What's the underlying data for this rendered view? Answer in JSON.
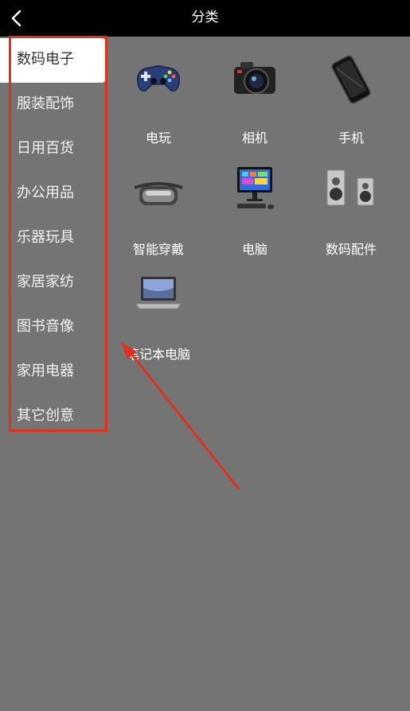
{
  "header": {
    "title": "分类"
  },
  "sidebar": {
    "items": [
      {
        "label": "数码电子",
        "active": true
      },
      {
        "label": "服装配饰"
      },
      {
        "label": "日用百货"
      },
      {
        "label": "办公用品"
      },
      {
        "label": "乐器玩具"
      },
      {
        "label": "家居家纺"
      },
      {
        "label": "图书音像"
      },
      {
        "label": "家用电器"
      },
      {
        "label": "其它创意"
      }
    ]
  },
  "products": [
    {
      "label": "电玩",
      "icon": "gamepad-icon"
    },
    {
      "label": "相机",
      "icon": "camera-icon"
    },
    {
      "label": "手机",
      "icon": "phone-icon"
    },
    {
      "label": "智能穿戴",
      "icon": "vr-headset-icon"
    },
    {
      "label": "电脑",
      "icon": "desktop-computer-icon"
    },
    {
      "label": "数码配件",
      "icon": "speakers-icon"
    },
    {
      "label": "笔记本电脑",
      "icon": "laptop-icon"
    }
  ],
  "colors": {
    "highlight": "#e0301e",
    "background": "#747474",
    "topbar": "#000000"
  }
}
